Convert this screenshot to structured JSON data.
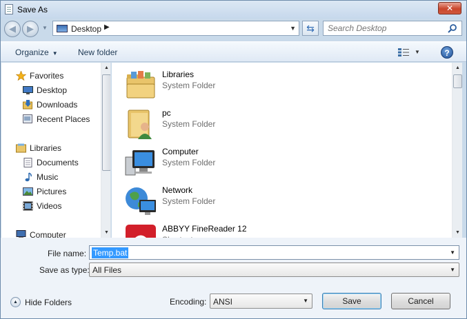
{
  "window": {
    "title": "Save As",
    "close_glyph": "✕"
  },
  "address_bar": {
    "location": "Desktop",
    "separator": "▶"
  },
  "search": {
    "placeholder": "Search Desktop"
  },
  "command_bar": {
    "organize": "Organize",
    "new_folder": "New folder",
    "help": "?"
  },
  "nav_pane": {
    "items": [
      {
        "label": "Favorites",
        "icon": "star-icon"
      },
      {
        "label": "Desktop",
        "icon": "desktop-icon"
      },
      {
        "label": "Downloads",
        "icon": "downloads-icon"
      },
      {
        "label": "Recent Places",
        "icon": "recent-places-icon"
      },
      {
        "label": "Libraries",
        "icon": "libraries-icon"
      },
      {
        "label": "Documents",
        "icon": "documents-icon"
      },
      {
        "label": "Music",
        "icon": "music-icon"
      },
      {
        "label": "Pictures",
        "icon": "pictures-icon"
      },
      {
        "label": "Videos",
        "icon": "videos-icon"
      },
      {
        "label": "Computer",
        "icon": "computer-icon"
      }
    ]
  },
  "file_list": {
    "items": [
      {
        "name": "Libraries",
        "type": "System Folder",
        "icon": "libraries-folder-icon"
      },
      {
        "name": "pc",
        "type": "System Folder",
        "icon": "user-folder-icon"
      },
      {
        "name": "Computer",
        "type": "System Folder",
        "icon": "computer-icon"
      },
      {
        "name": "Network",
        "type": "System Folder",
        "icon": "network-icon"
      },
      {
        "name": "ABBYY FineReader 12",
        "type": "Shortcut",
        "icon": "abbyy-icon"
      }
    ]
  },
  "form": {
    "file_name_label": "File name:",
    "file_name_value": "Temp.bat",
    "save_type_label": "Save as type:",
    "save_type_value": "All Files"
  },
  "footer": {
    "hide_folders": "Hide Folders",
    "encoding_label": "Encoding:",
    "encoding_value": "ANSI",
    "save": "Save",
    "cancel": "Cancel"
  }
}
